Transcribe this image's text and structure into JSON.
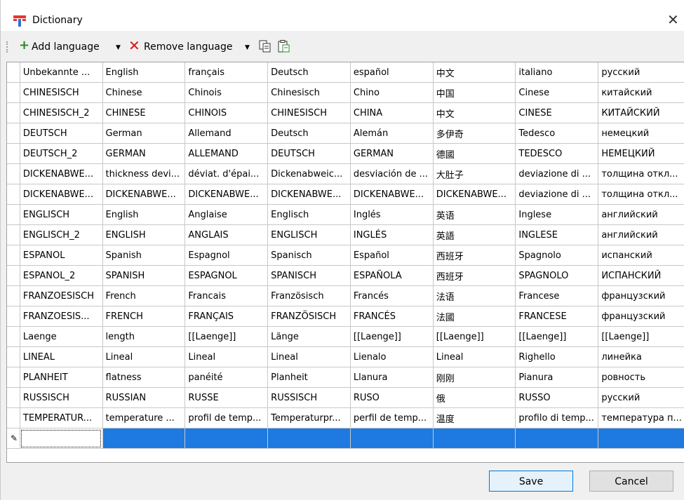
{
  "window": {
    "title": "Dictionary"
  },
  "toolbar": {
    "add_language": "Add language",
    "remove_language": "Remove language"
  },
  "table": {
    "headers": [
      "Unbekannte ...",
      "English",
      "français",
      "Deutsch",
      "español",
      "中文",
      "italiano",
      "русский"
    ],
    "rows": [
      [
        "CHINESISCH",
        "Chinese",
        "Chinois",
        "Chinesisch",
        "Chino",
        "中国",
        "Cinese",
        "китайский"
      ],
      [
        "CHINESISCH_2",
        "CHINESE",
        "CHINOIS",
        "CHINESISCH",
        "CHINA",
        "中文",
        "CINESE",
        "КИТАЙСКИЙ"
      ],
      [
        "DEUTSCH",
        "German",
        "Allemand",
        "Deutsch",
        "Alemán",
        "多伊奇",
        "Tedesco",
        "немецкий"
      ],
      [
        "DEUTSCH_2",
        "GERMAN",
        "ALLEMAND",
        "DEUTSCH",
        "GERMAN",
        "德國",
        "TEDESCO",
        "НЕМЕЦКИЙ"
      ],
      [
        "DICKENABWE...",
        "thickness devi...",
        "déviat. d'épai...",
        "Dickenabweic...",
        "desviación de ...",
        "大肚子",
        "deviazione di ...",
        "толщина откл..."
      ],
      [
        "DICKENABWE...",
        "DICKENABWE...",
        "DICKENABWE...",
        "DICKENABWE...",
        "DICKENABWE...",
        "DICKENABWE...",
        "deviazione di ...",
        "толщина откл..."
      ],
      [
        "ENGLISCH",
        "English",
        "Anglaise",
        "Englisch",
        "Inglés",
        "英语",
        "Inglese",
        "английский"
      ],
      [
        "ENGLISCH_2",
        "ENGLISH",
        "ANGLAIS",
        "ENGLISCH",
        "INGLÉS",
        "英語",
        "INGLESE",
        "английский"
      ],
      [
        "ESPANOL",
        "Spanish",
        "Espagnol",
        "Spanisch",
        "Español",
        "西班牙",
        "Spagnolo",
        "испанский"
      ],
      [
        "ESPANOL_2",
        "SPANISH",
        "ESPAGNOL",
        "SPANISCH",
        "ESPAÑOLA",
        "西班牙",
        "SPAGNOLO",
        "ИСПАНСКИЙ"
      ],
      [
        "FRANZOESISCH",
        "French",
        "Francais",
        "Französisch",
        "Francés",
        "法语",
        "Francese",
        "французский"
      ],
      [
        "FRANZOESIS...",
        "FRENCH",
        "FRANÇAIS",
        "FRANZÖSISCH",
        "FRANCÉS",
        "法國",
        "FRANCESE",
        "французский"
      ],
      [
        "Laenge",
        "length",
        "[[Laenge]]",
        "Länge",
        "[[Laenge]]",
        "[[Laenge]]",
        "[[Laenge]]",
        "[[Laenge]]"
      ],
      [
        "LINEAL",
        "Lineal",
        "Lineal",
        "Lineal",
        "Lienalo",
        "Lineal",
        "Righello",
        "линейка"
      ],
      [
        "PLANHEIT",
        "flatness",
        "panéité",
        "Planheit",
        "Llanura",
        "刚刚",
        "Pianura",
        "ровность"
      ],
      [
        "RUSSISCH",
        "RUSSIAN",
        "RUSSE",
        "RUSSISCH",
        "RUSO",
        "俄",
        "RUSSO",
        "русский"
      ],
      [
        "TEMPERATUR...",
        "temperature ...",
        "profil de temp...",
        "Temperaturpr...",
        "perfil de temp...",
        "温度",
        "profilo di temp...",
        "температура п..."
      ]
    ]
  },
  "buttons": {
    "save": "Save",
    "cancel": "Cancel"
  },
  "colors": {
    "selection": "#1e7ae0",
    "add_icon": "#2a8a2a",
    "remove_icon": "#e01010"
  }
}
